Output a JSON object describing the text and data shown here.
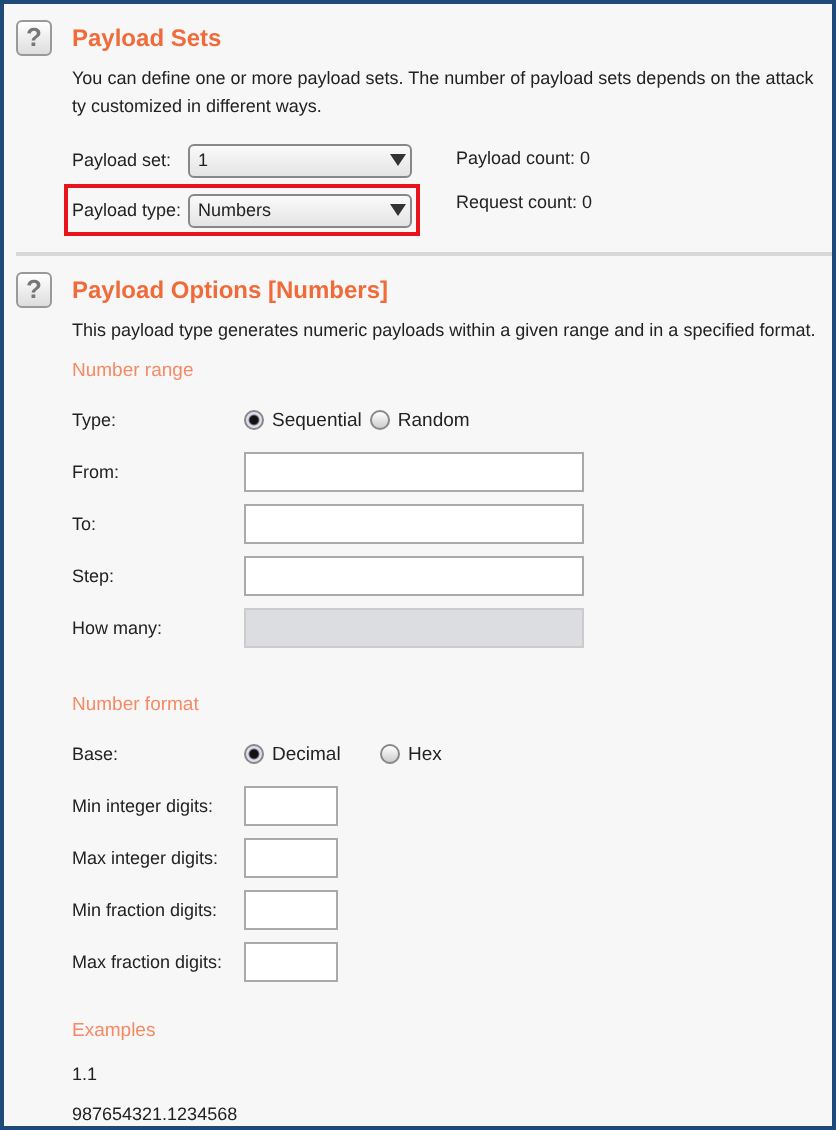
{
  "payload_sets": {
    "help_icon": "?",
    "title": "Payload Sets",
    "description": "You can define one or more payload sets. The number of payload sets depends on the attack ty customized in different ways.",
    "rows": [
      {
        "label": "Payload set:",
        "value": "1",
        "info": "Payload count: 0",
        "highlighted": false
      },
      {
        "label": "Payload type:",
        "value": "Numbers",
        "info": "Request count: 0",
        "highlighted": true
      }
    ]
  },
  "payload_options": {
    "help_icon": "?",
    "title": "Payload Options [Numbers]",
    "description": "This payload type generates numeric payloads within a given range and in a specified format.",
    "number_range": {
      "heading": "Number range",
      "type_label": "Type:",
      "radios": [
        {
          "label": "Sequential",
          "selected": true
        },
        {
          "label": "Random",
          "selected": false
        }
      ],
      "fields": [
        {
          "label": "From:",
          "disabled": false
        },
        {
          "label": "To:",
          "disabled": false
        },
        {
          "label": "Step:",
          "disabled": false
        },
        {
          "label": "How many:",
          "disabled": true
        }
      ]
    },
    "number_format": {
      "heading": "Number format",
      "base_label": "Base:",
      "radios": [
        {
          "label": "Decimal",
          "selected": true
        },
        {
          "label": "Hex",
          "selected": false
        }
      ],
      "fields": [
        {
          "label": "Min integer digits:"
        },
        {
          "label": "Max integer digits:"
        },
        {
          "label": "Min fraction digits:"
        },
        {
          "label": "Max fraction digits:"
        }
      ]
    },
    "examples": {
      "heading": "Examples",
      "items": [
        "1.1",
        "987654321.1234568"
      ]
    }
  }
}
